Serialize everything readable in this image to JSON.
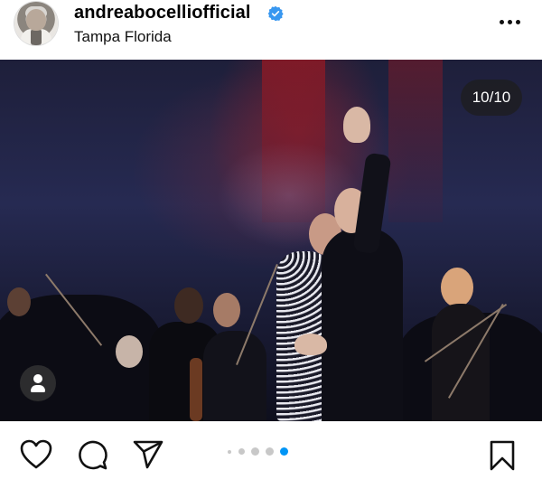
{
  "header": {
    "username": "andreabocelliofficial",
    "location": "Tampa Florida"
  },
  "photo": {
    "counter": "10/10"
  },
  "carousel": {
    "total": 5,
    "active_index": 4
  },
  "colors": {
    "verified_badge": "#3897f0",
    "active_dot": "#0095f6",
    "inactive_dot": "#c8c8c8"
  },
  "icons": [
    "more-options-icon",
    "user-tag-icon",
    "heart-icon",
    "comment-icon",
    "share-icon",
    "bookmark-icon"
  ]
}
